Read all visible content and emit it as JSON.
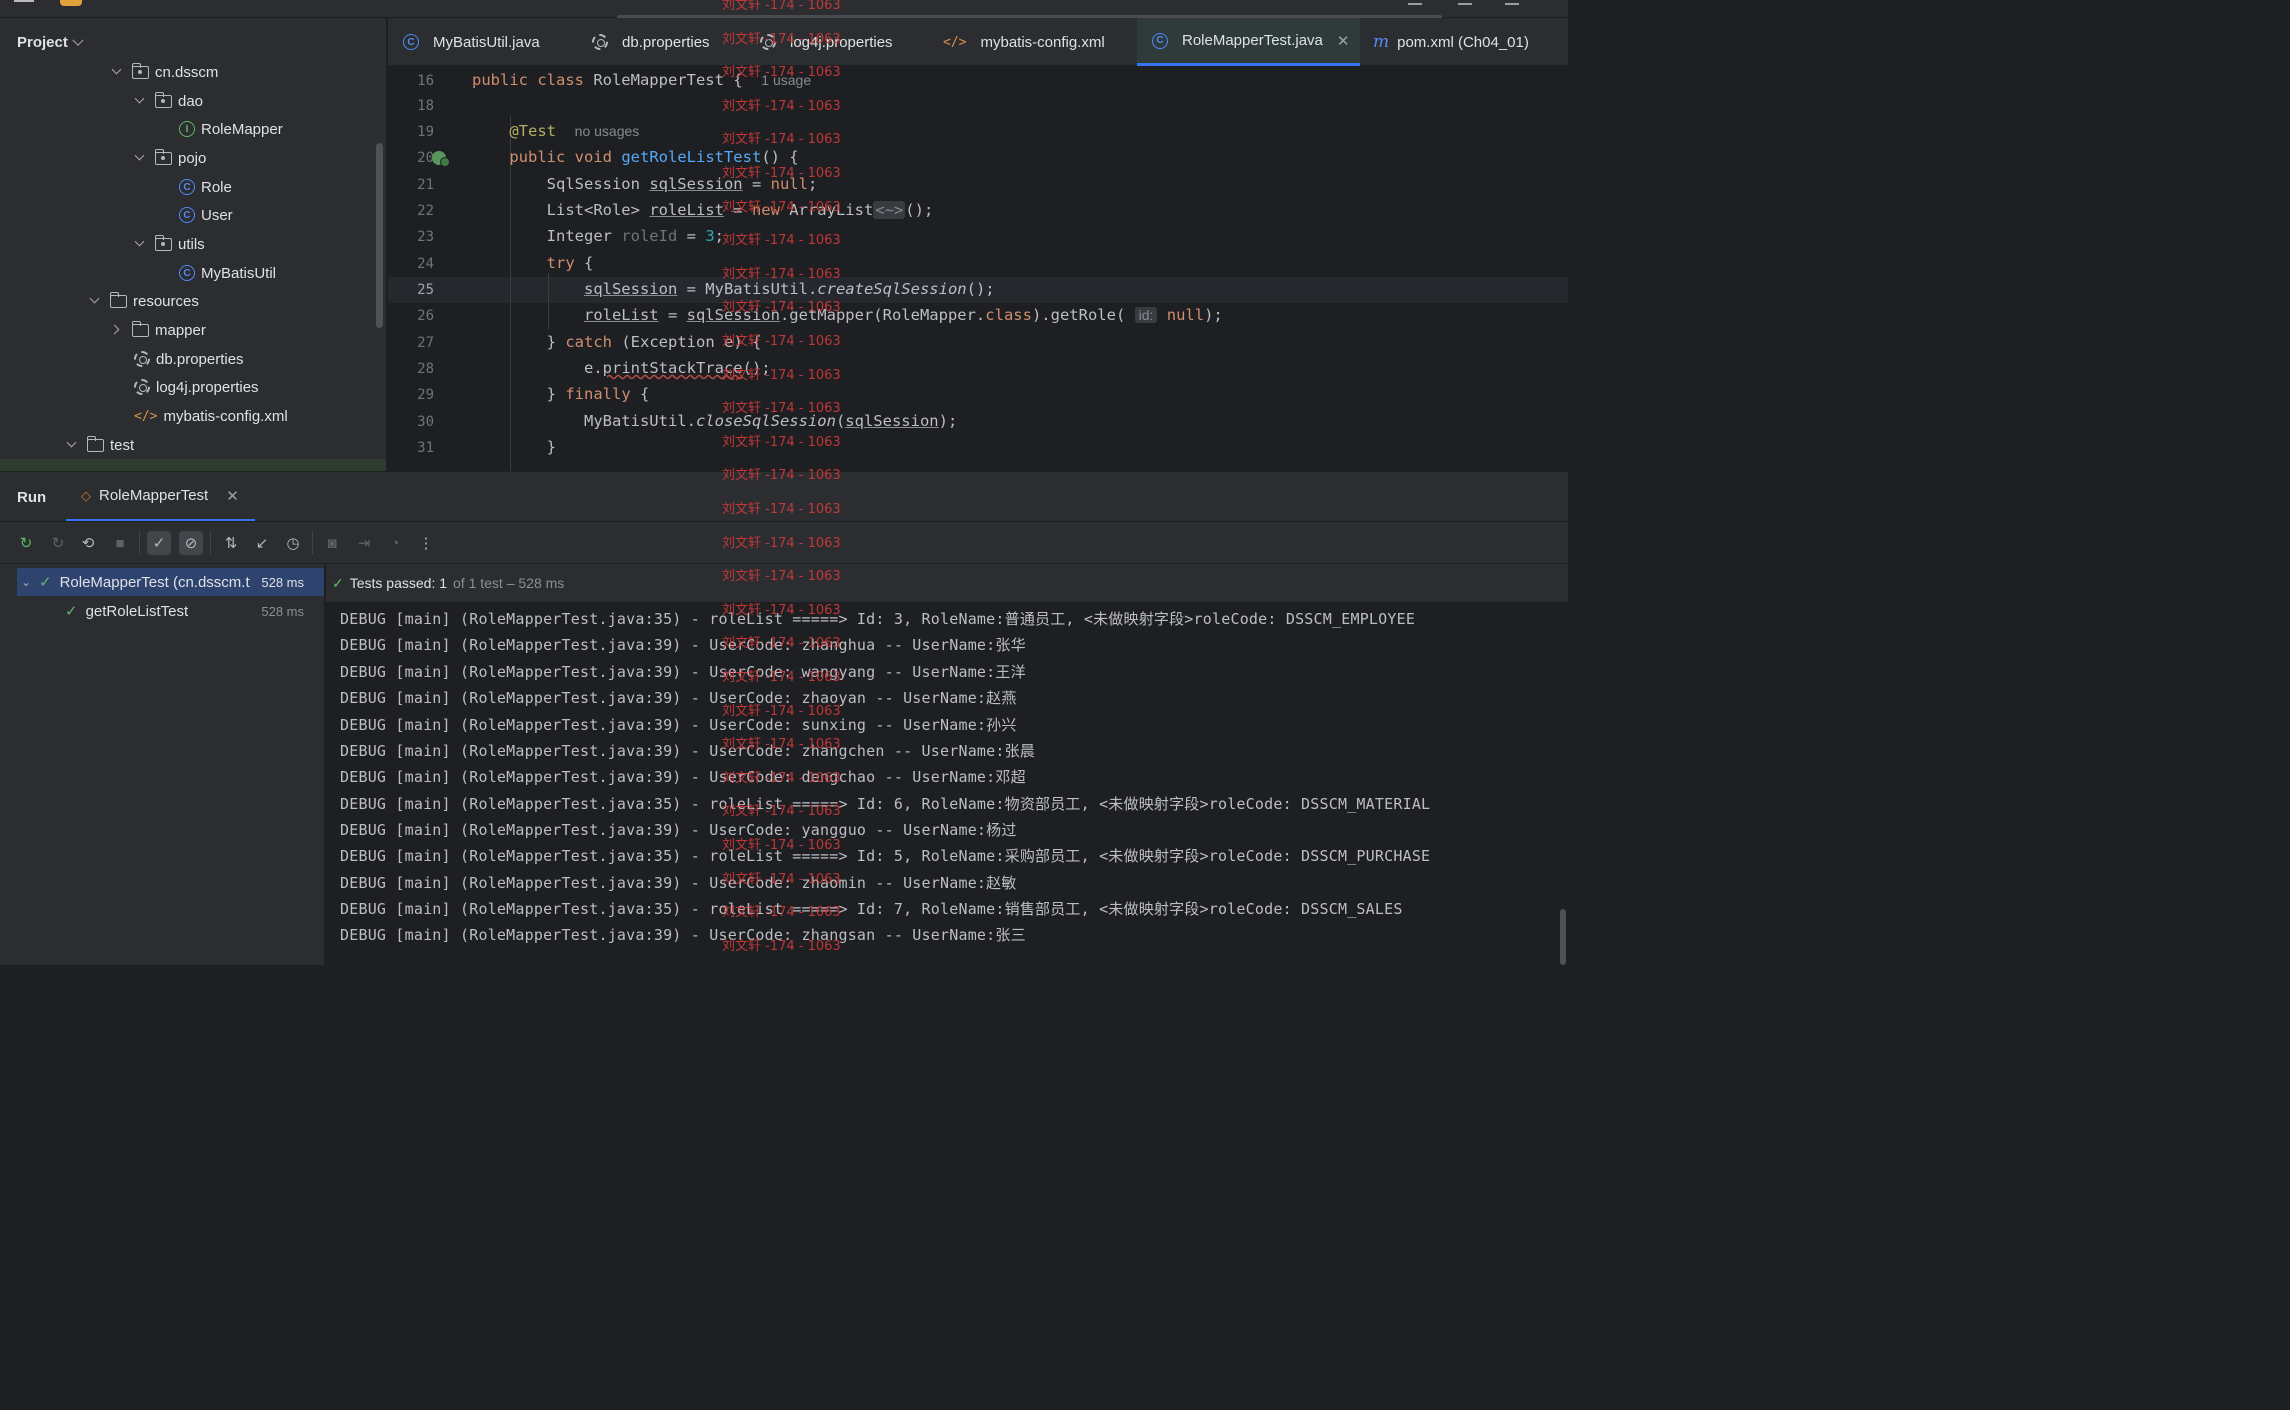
{
  "project_panel": {
    "title": "Project",
    "tree": [
      {
        "label": "cn.dsscm",
        "kind": "package"
      },
      {
        "label": "dao",
        "kind": "package"
      },
      {
        "label": "RoleMapper",
        "kind": "interface"
      },
      {
        "label": "pojo",
        "kind": "package"
      },
      {
        "label": "Role",
        "kind": "class"
      },
      {
        "label": "User",
        "kind": "class"
      },
      {
        "label": "utils",
        "kind": "package"
      },
      {
        "label": "MyBatisUtil",
        "kind": "class"
      },
      {
        "label": "resources",
        "kind": "folder"
      },
      {
        "label": "mapper",
        "kind": "folder"
      },
      {
        "label": "db.properties",
        "kind": "properties"
      },
      {
        "label": "log4j.properties",
        "kind": "properties"
      },
      {
        "label": "mybatis-config.xml",
        "kind": "xml"
      },
      {
        "label": "test",
        "kind": "folder"
      }
    ]
  },
  "editor_tabs": [
    {
      "label": "MyBatisUtil.java",
      "icon": "class-icon"
    },
    {
      "label": "db.properties",
      "icon": "gear-icon"
    },
    {
      "label": "log4j.properties",
      "icon": "gear-icon"
    },
    {
      "label": "mybatis-config.xml",
      "icon": "xml-icon"
    },
    {
      "label": "RoleMapperTest.java",
      "icon": "test-class-icon",
      "active": true
    },
    {
      "label": "pom.xml (Ch04_01)",
      "icon": "maven-icon"
    }
  ],
  "editor": {
    "line_numbers": [
      "16",
      "18",
      "19",
      "20",
      "21",
      "22",
      "23",
      "24",
      "25",
      "26",
      "27",
      "28",
      "29",
      "30",
      "31"
    ],
    "current_line": "25",
    "hints": {
      "usage": "1 usage",
      "no_usages": "no usages",
      "param_id": "id:"
    }
  },
  "run_panel": {
    "title": "Run",
    "tab_label": "RoleMapperTest",
    "test_tree": [
      {
        "label": "RoleMapperTest (cn.dsscm.t",
        "time": "528 ms"
      },
      {
        "label": "getRoleListTest",
        "time": "528 ms"
      }
    ],
    "status": {
      "passed": "Tests passed: 1",
      "detail": "of 1 test – 528 ms"
    },
    "log_lines": [
      "DEBUG [main] (RoleMapperTest.java:35) - roleList =====> Id: 3, RoleName:普通员工, <未做映射字段>roleCode: DSSCM_EMPLOYEE",
      "DEBUG [main] (RoleMapperTest.java:39) - UserCode: zhanghua -- UserName:张华",
      "DEBUG [main] (RoleMapperTest.java:39) - UserCode: wangyang -- UserName:王洋",
      "DEBUG [main] (RoleMapperTest.java:39) - UserCode: zhaoyan -- UserName:赵燕",
      "DEBUG [main] (RoleMapperTest.java:39) - UserCode: sunxing -- UserName:孙兴",
      "DEBUG [main] (RoleMapperTest.java:39) - UserCode: zhangchen -- UserName:张晨",
      "DEBUG [main] (RoleMapperTest.java:39) - UserCode: dengchao -- UserName:邓超",
      "DEBUG [main] (RoleMapperTest.java:35) - roleList =====> Id: 6, RoleName:物资部员工, <未做映射字段>roleCode: DSSCM_MATERIAL",
      "DEBUG [main] (RoleMapperTest.java:39) - UserCode: yangguo -- UserName:杨过",
      "DEBUG [main] (RoleMapperTest.java:35) - roleList =====> Id: 5, RoleName:采购部员工, <未做映射字段>roleCode: DSSCM_PURCHASE",
      "DEBUG [main] (RoleMapperTest.java:39) - UserCode: zhaomin -- UserName:赵敏",
      "DEBUG [main] (RoleMapperTest.java:35) - roleList =====> Id: 7, RoleName:销售部员工, <未做映射字段>roleCode: DSSCM_SALES",
      "DEBUG [main] (RoleMapperTest.java:39) - UserCode: zhangsan -- UserName:张三"
    ]
  },
  "watermark": "刘文轩 -174 - 1063",
  "colors": {
    "accent": "#3574f0",
    "success": "#5fb865",
    "keyword": "#cf8e6d",
    "method": "#56a8f5",
    "watermark": "#d23a3a"
  }
}
